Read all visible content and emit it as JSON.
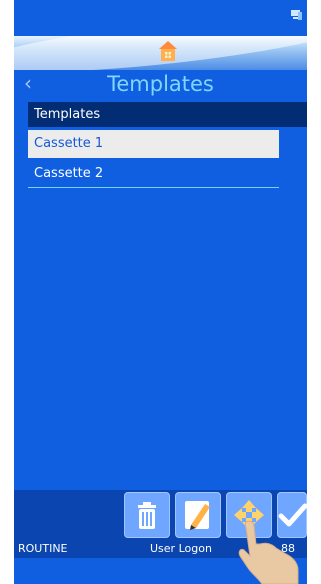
{
  "header": {
    "title": "Templates"
  },
  "list": {
    "header": "Templates",
    "items": [
      "Cassette 1",
      "Cassette 2"
    ]
  },
  "status": {
    "mode": "ROUTINE",
    "user": "User Logon",
    "count": "88"
  }
}
